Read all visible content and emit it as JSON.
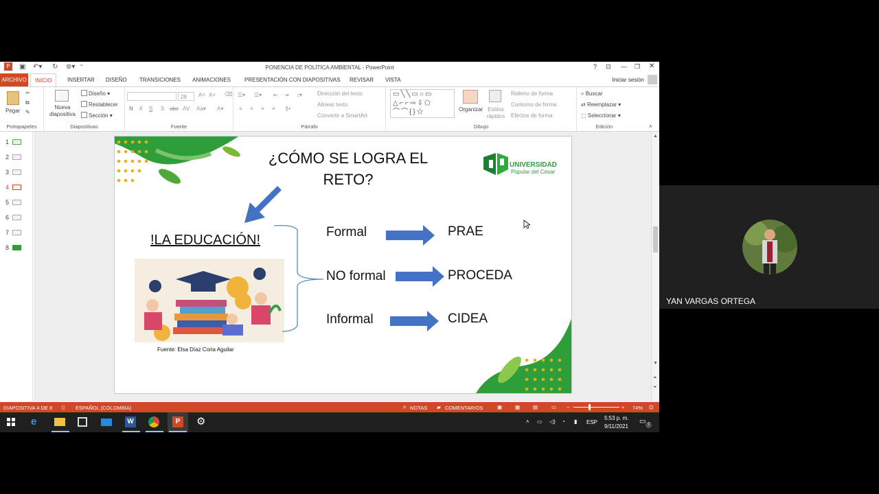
{
  "window": {
    "title": "PONENCIA DE POLÍTICA AMBIENTAL - PowerPoint",
    "help": "?",
    "sign_in": "Iniciar sesión"
  },
  "tabs": [
    "ARCHIVO",
    "INICIO",
    "INSERTAR",
    "DISEÑO",
    "TRANSICIONES",
    "ANIMACIONES",
    "PRESENTACIÓN CON DIAPOSITIVAS",
    "REVISAR",
    "VISTA"
  ],
  "ribbon": {
    "portapapeles": {
      "paste": "Pegar",
      "label": "Portapapeles"
    },
    "diapositivas": {
      "new_slide": "Nueva diapositiva",
      "layout": "Diseño",
      "reset": "Restablecer",
      "section": "Sección",
      "label": "Diapositivas"
    },
    "fuente": {
      "size": "28",
      "label": "Fuente",
      "bold": "N",
      "italic": "K",
      "underline": "S"
    },
    "parrafo": {
      "text_dir": "Dirección del texto",
      "align_text": "Alinear texto",
      "smartart": "Convertir a SmartArt",
      "label": "Párrafo"
    },
    "dibujo": {
      "arrange": "Organizar",
      "quick_styles": "Estilos rápidos",
      "fill": "Relleno de forma",
      "outline": "Contorno de forma",
      "effects": "Efectos de forma",
      "label": "Dibujo"
    },
    "edicion": {
      "find": "Buscar",
      "replace": "Reemplazar",
      "select": "Seleccionar",
      "label": "Edición"
    }
  },
  "thumbnails": [
    "1",
    "2",
    "3",
    "4",
    "5",
    "6",
    "7",
    "8"
  ],
  "selected_slide": "4",
  "slide": {
    "title": "¿CÓMO SE LOGRA EL RETO?",
    "subtitle": "!LA EDUCACIÓN!",
    "source": "Fuente: Elsa Díaz Coria Aguilar",
    "logo_title": "UNIVERSIDAD",
    "logo_sub": "Popular del Cesar",
    "rows": [
      {
        "category": "Formal",
        "result": "PRAE"
      },
      {
        "category": "NO formal",
        "result": "PROCEDA"
      },
      {
        "category": "Informal",
        "result": "CIDEA"
      }
    ]
  },
  "status": {
    "slide_of": "DIAPOSITIVA 4 DE 8",
    "language": "ESPAÑOL (COLOMBIA)",
    "notes": "NOTAS",
    "comments": "COMENTARIOS",
    "zoom": "74%"
  },
  "taskbar": {
    "lang": "ESP",
    "time": "5:53 p. m.",
    "date": "9/11/2021",
    "notif": "7"
  },
  "participant": {
    "name": "YAN VARGAS ORTEGA"
  },
  "colors": {
    "accent": "#d24726",
    "arrow": "#4472c4",
    "green": "#2e9e3a"
  }
}
